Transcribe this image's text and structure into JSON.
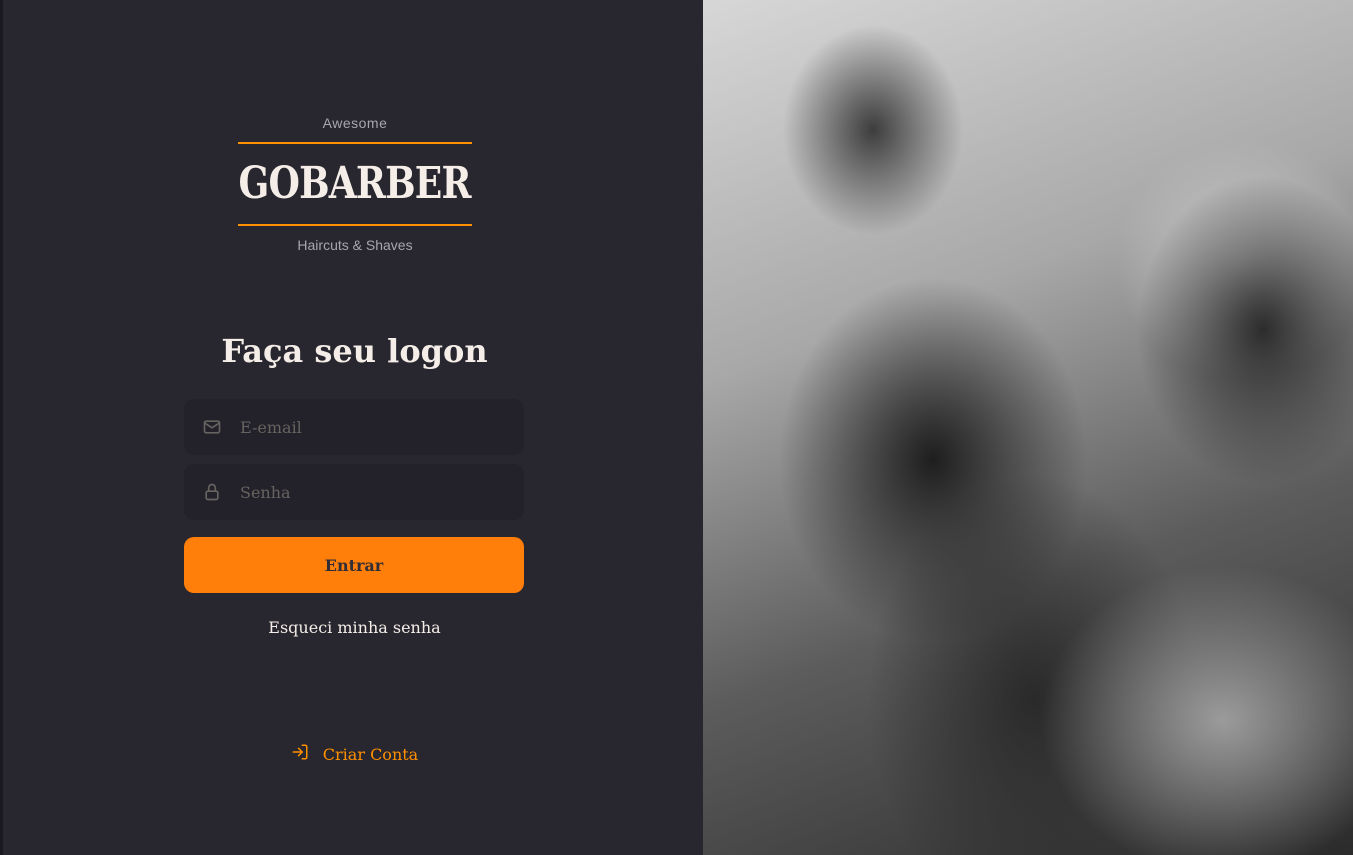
{
  "brand": {
    "top": "Awesome",
    "name": "GOBARBER",
    "bottom": "Haircuts & Shaves",
    "accent": "#ff9000"
  },
  "form": {
    "title": "Faça seu logon",
    "email_placeholder": "E-email",
    "password_placeholder": "Senha",
    "submit_label": "Entrar",
    "forgot_label": "Esqueci minha senha"
  },
  "signup": {
    "label": "Criar Conta"
  },
  "icons": {
    "email": "mail-icon",
    "password": "lock-icon",
    "signup": "log-in-icon"
  }
}
